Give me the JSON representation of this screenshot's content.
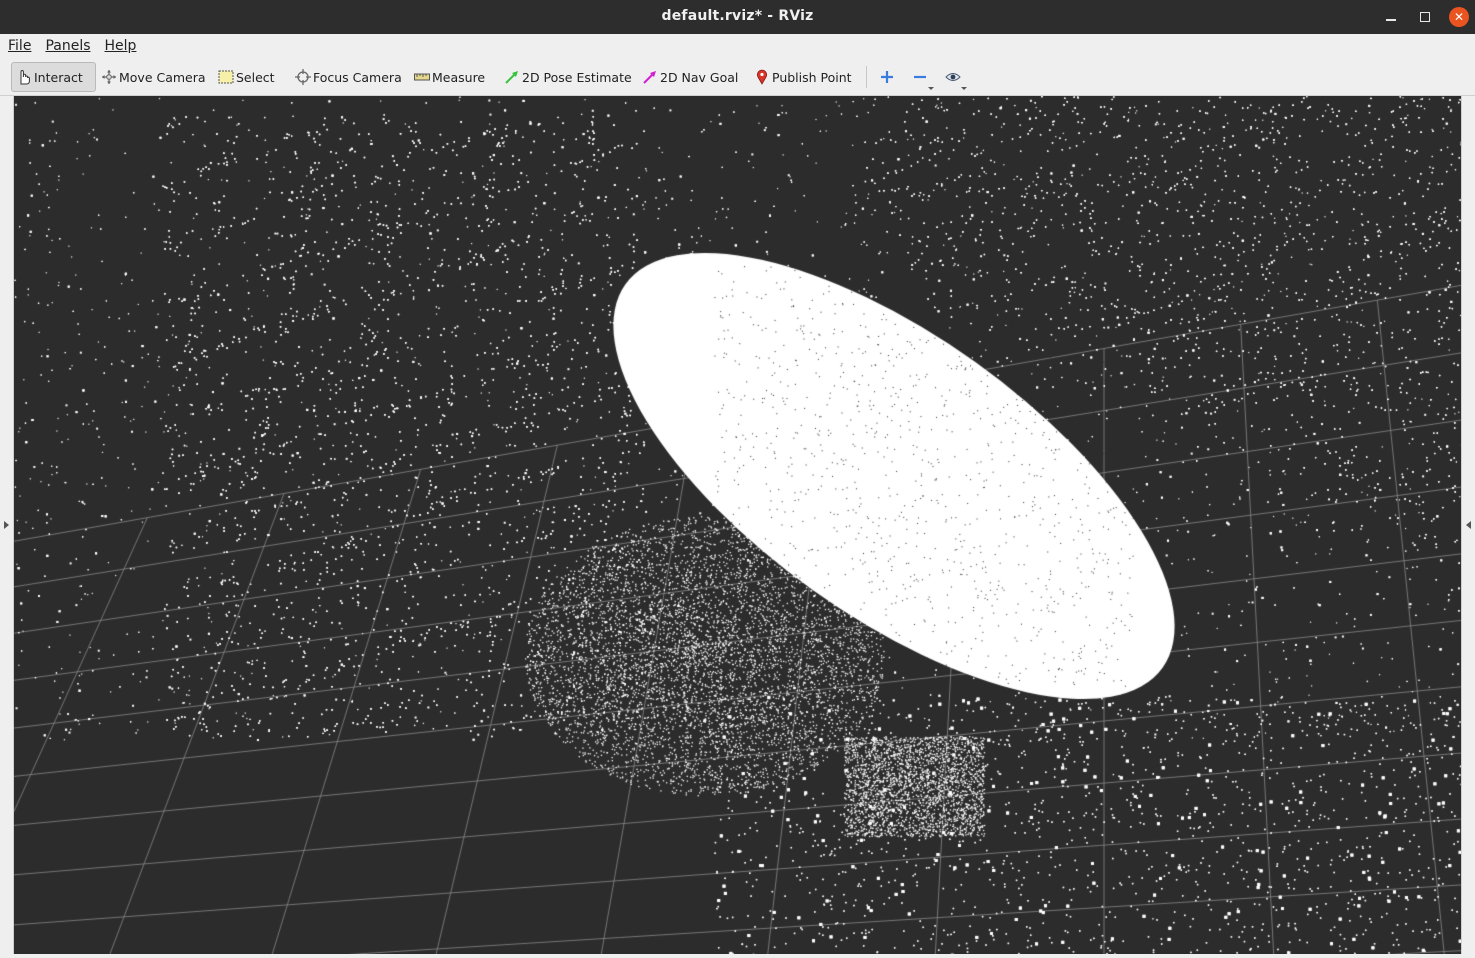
{
  "window": {
    "title": "default.rviz* - RViz",
    "close_glyph": "✕"
  },
  "menu": {
    "file": "File",
    "panels": "Panels",
    "help": "Help"
  },
  "toolbar": {
    "interact": "Interact",
    "move_camera": "Move Camera",
    "select": "Select",
    "focus_camera": "Focus Camera",
    "measure": "Measure",
    "pose_estimate": "2D Pose Estimate",
    "nav_goal": "2D Nav Goal",
    "publish_point": "Publish Point",
    "active_tool": "Interact"
  },
  "icons": {
    "interact": "hand-pointer-icon",
    "move_camera": "move-camera-icon",
    "select": "select-box-icon",
    "focus_camera": "focus-crosshair-icon",
    "measure": "ruler-icon",
    "pose_estimate": "green-arrow-icon",
    "nav_goal": "magenta-arrow-icon",
    "publish_point": "map-pin-icon",
    "add_tool": "plus-icon",
    "remove_tool": "minus-icon",
    "view": "eye-icon"
  },
  "colors": {
    "pose_estimate": "#36c23a",
    "nav_goal": "#d21fd2",
    "publish_point": "#d9332b",
    "add": "#3a7be0",
    "remove": "#3a7be0",
    "viewport_bg": "#2c2c2c",
    "grid": "#8a8a8a",
    "points": "#ffffff"
  },
  "viewport": {
    "content": "3D point cloud with reference grid"
  }
}
